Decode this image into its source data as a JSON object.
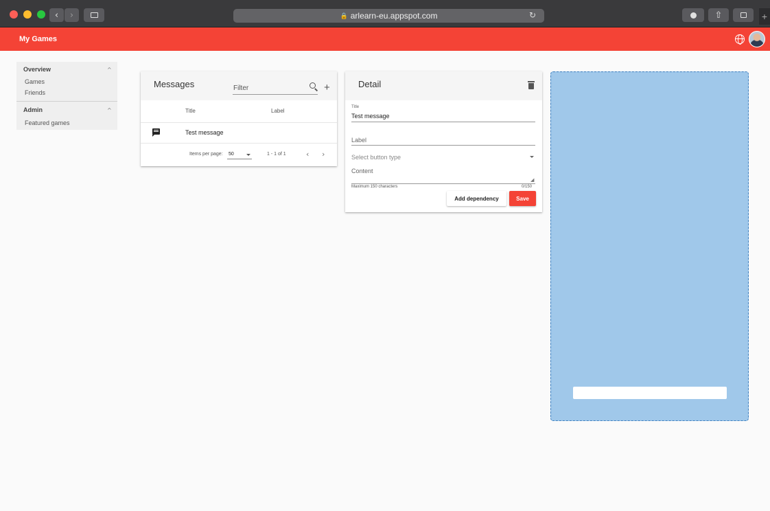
{
  "browser": {
    "url": "arlearn-eu.appspot.com"
  },
  "app": {
    "title": "My Games"
  },
  "sidebar": {
    "sections": [
      {
        "title": "Overview",
        "items": [
          "Games",
          "Friends"
        ]
      },
      {
        "title": "Admin",
        "items": [
          "Featured games"
        ]
      }
    ]
  },
  "messages": {
    "title": "Messages",
    "filter_label": "Filter",
    "columns": [
      "Title",
      "Label"
    ],
    "rows": [
      {
        "title": "Test message",
        "label": ""
      }
    ],
    "pagination": {
      "items_per_page_label": "Items per page:",
      "items_per_page": "50",
      "range": "1 - 1 of 1"
    }
  },
  "detail": {
    "title": "Detail",
    "title_field_label": "Title",
    "title_field_value": "Test message",
    "label_placeholder": "Label",
    "button_type_placeholder": "Select button type",
    "content_placeholder": "Content",
    "hint": "Maximum 150 characters",
    "counter": "0/150",
    "add_dependency_label": "Add dependency",
    "save_label": "Save"
  },
  "icons": {
    "back": "chevron-left-icon",
    "forward": "chevron-right-icon",
    "sidebar_toggle": "sidebar-icon",
    "reload": "reload-icon",
    "download": "download-icon",
    "share": "share-icon",
    "tabs": "tabs-icon",
    "language": "globe-icon",
    "search": "search-icon",
    "add": "plus-icon",
    "message": "chat-icon",
    "delete": "trash-icon"
  },
  "colors": {
    "accent": "#f44336",
    "preview_bg": "#a0c8ea",
    "preview_border": "#3e7fbf"
  }
}
